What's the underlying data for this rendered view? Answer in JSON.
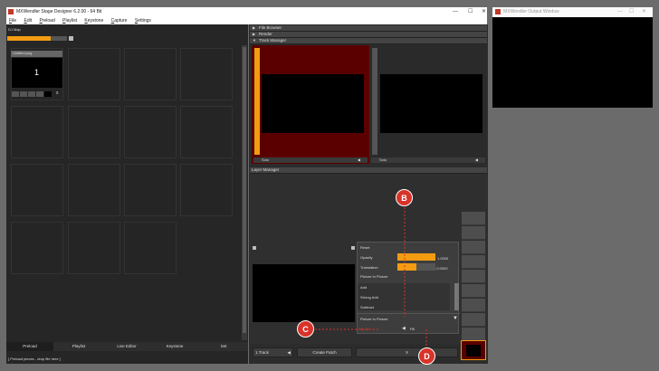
{
  "main_window": {
    "title": "MXWendler Stage Designer 6.2.00  -  64 Bit",
    "menu": [
      {
        "key": "F",
        "rest": "ile"
      },
      {
        "key": "E",
        "rest": "dit"
      },
      {
        "key": "P",
        "rest": "reload"
      },
      {
        "key": "P",
        "rest": "laylist"
      },
      {
        "key": "K",
        "rest": "eystone"
      },
      {
        "key": "C",
        "rest": "apture"
      },
      {
        "key": "S",
        "rest": "ettings"
      }
    ]
  },
  "output_window": {
    "title": "MXWendler Output Window"
  },
  "window_controls": {
    "min": "—",
    "max": "☐",
    "close": "✕"
  },
  "dj_map": {
    "label": "DJ Map",
    "progress": 0.72,
    "clip": {
      "name": "Untitled.png",
      "number": "1",
      "x": "x"
    }
  },
  "bottom_tabs": [
    "Preload",
    "Playlist",
    "Live Editor",
    "Keystone",
    "Set"
  ],
  "status": "[ Preload pieces - drop file here ]",
  "sections": {
    "file_browser": "File Browser",
    "render": "Render",
    "track_manager": "Track Manager",
    "layer_manager": "Layer Manager"
  },
  "tracks": [
    {
      "label": "Solo"
    },
    {
      "label": "Solo"
    }
  ],
  "context_menu": {
    "reset": "Reset",
    "opacity": {
      "label": "Opacity",
      "value": "1.0000",
      "fill": 1.0
    },
    "translation": {
      "label": "Translation",
      "value": "-0.0000",
      "fill": 0.5
    },
    "picture_in_picture": "Picture In Picture",
    "add": "Add",
    "strong_add": "Strong Add",
    "subtract": "Subtract",
    "pip_bottom": "Picture In Picture",
    "fill": "Fill",
    "red_label": "B_Fill"
  },
  "buttons": {
    "track": "1.Track",
    "create_patch": "Create Patch",
    "x": "X"
  },
  "callouts": [
    "B",
    "C",
    "D"
  ],
  "colors": {
    "orange": "#f39c12",
    "callout": "#d8332a",
    "dark_red": "#5a0000"
  }
}
